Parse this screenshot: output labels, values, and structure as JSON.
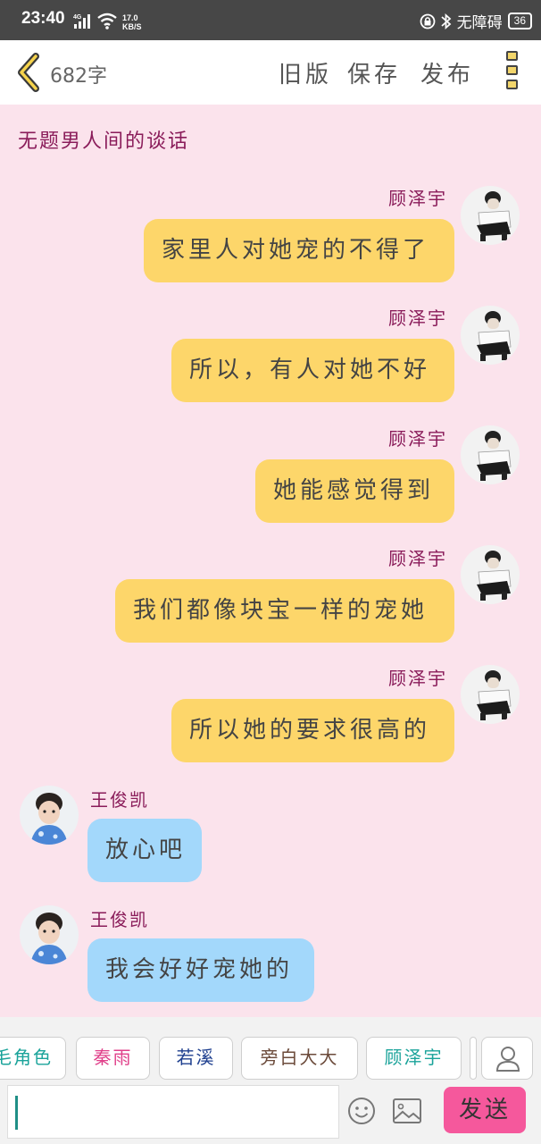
{
  "status_bar": {
    "time": "23:40",
    "network_type": "4G",
    "speed_value": "17.0",
    "speed_unit": "KB/S",
    "accessibility_label": "无障碍",
    "battery": "36"
  },
  "toolbar": {
    "word_count": "682字",
    "old_version_label": "旧版",
    "save_label": "保存",
    "publish_label": "发布"
  },
  "chat": {
    "title": "无题男人间的谈话",
    "messages": [
      {
        "speaker": "顾泽宇",
        "text": "家里人对她宠的不得了",
        "side": "right"
      },
      {
        "speaker": "顾泽宇",
        "text": "所以，有人对她不好",
        "side": "right"
      },
      {
        "speaker": "顾泽宇",
        "text": "她能感觉得到",
        "side": "right"
      },
      {
        "speaker": "顾泽宇",
        "text": "我们都像块宝一样的宠她",
        "side": "right"
      },
      {
        "speaker": "顾泽宇",
        "text": "所以她的要求很高的",
        "side": "right"
      },
      {
        "speaker": "王俊凯",
        "text": "放心吧",
        "side": "left"
      },
      {
        "speaker": "王俊凯",
        "text": "我会好好宠她的",
        "side": "left"
      }
    ]
  },
  "characters": [
    {
      "name": "毛角色",
      "color": "#1aa39a"
    },
    {
      "name": "秦雨",
      "color": "#e0408a"
    },
    {
      "name": "若溪",
      "color": "#1e3f8f"
    },
    {
      "name": "旁白大大",
      "color": "#6b4a3a"
    },
    {
      "name": "顾泽宇",
      "color": "#1aa39a"
    }
  ],
  "input": {
    "value": "",
    "send_label": "发送"
  },
  "colors": {
    "right_bubble": "#fdd66a",
    "left_bubble": "#a3d8fb",
    "background": "#fbe3ec",
    "name_color": "#8a1c5a",
    "send_button": "#f5589c"
  }
}
